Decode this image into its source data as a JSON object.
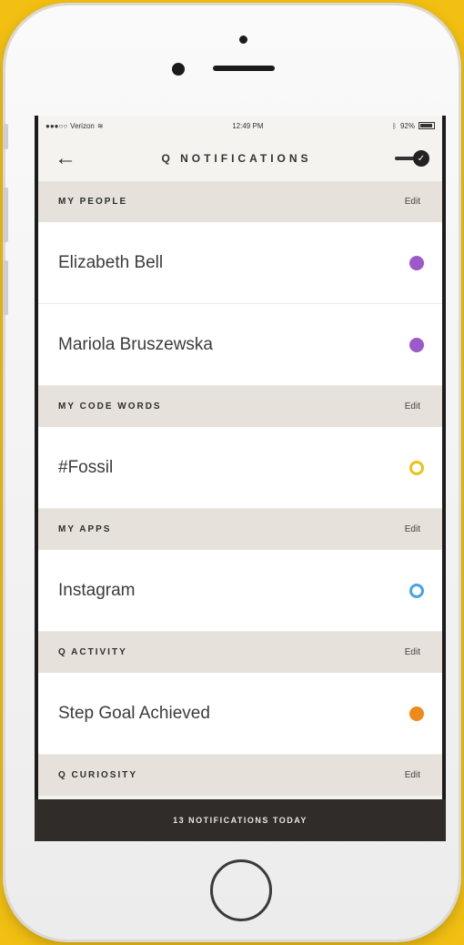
{
  "status_bar": {
    "carrier": "Verizon",
    "time": "12:49 PM",
    "battery": "92%"
  },
  "nav": {
    "title": "Q NOTIFICATIONS"
  },
  "sections": [
    {
      "title": "MY PEOPLE",
      "edit": "Edit",
      "items": [
        {
          "label": "Elizabeth Bell",
          "indicator_color": "#9b59c9"
        },
        {
          "label": "Mariola Bruszewska",
          "indicator_color": "#9b59c9"
        }
      ]
    },
    {
      "title": "MY CODE WORDS",
      "edit": "Edit",
      "items": [
        {
          "label": "#Fossil",
          "indicator_color": "#e8c41a"
        }
      ]
    },
    {
      "title": "MY APPS",
      "edit": "Edit",
      "items": [
        {
          "label": "Instagram",
          "indicator_color": "#4aa3e0"
        }
      ]
    },
    {
      "title": "Q ACTIVITY",
      "edit": "Edit",
      "items": [
        {
          "label": "Step Goal Achieved",
          "indicator_color": "#ee8a1c"
        }
      ]
    },
    {
      "title": "Q CURIOSITY",
      "edit": "Edit",
      "items": []
    }
  ],
  "footer": {
    "text": "13 NOTIFICATIONS TODAY"
  },
  "colors": {
    "background": "#f2c012",
    "header_band": "#e6e1db",
    "footer_bar": "#2f2c29"
  }
}
